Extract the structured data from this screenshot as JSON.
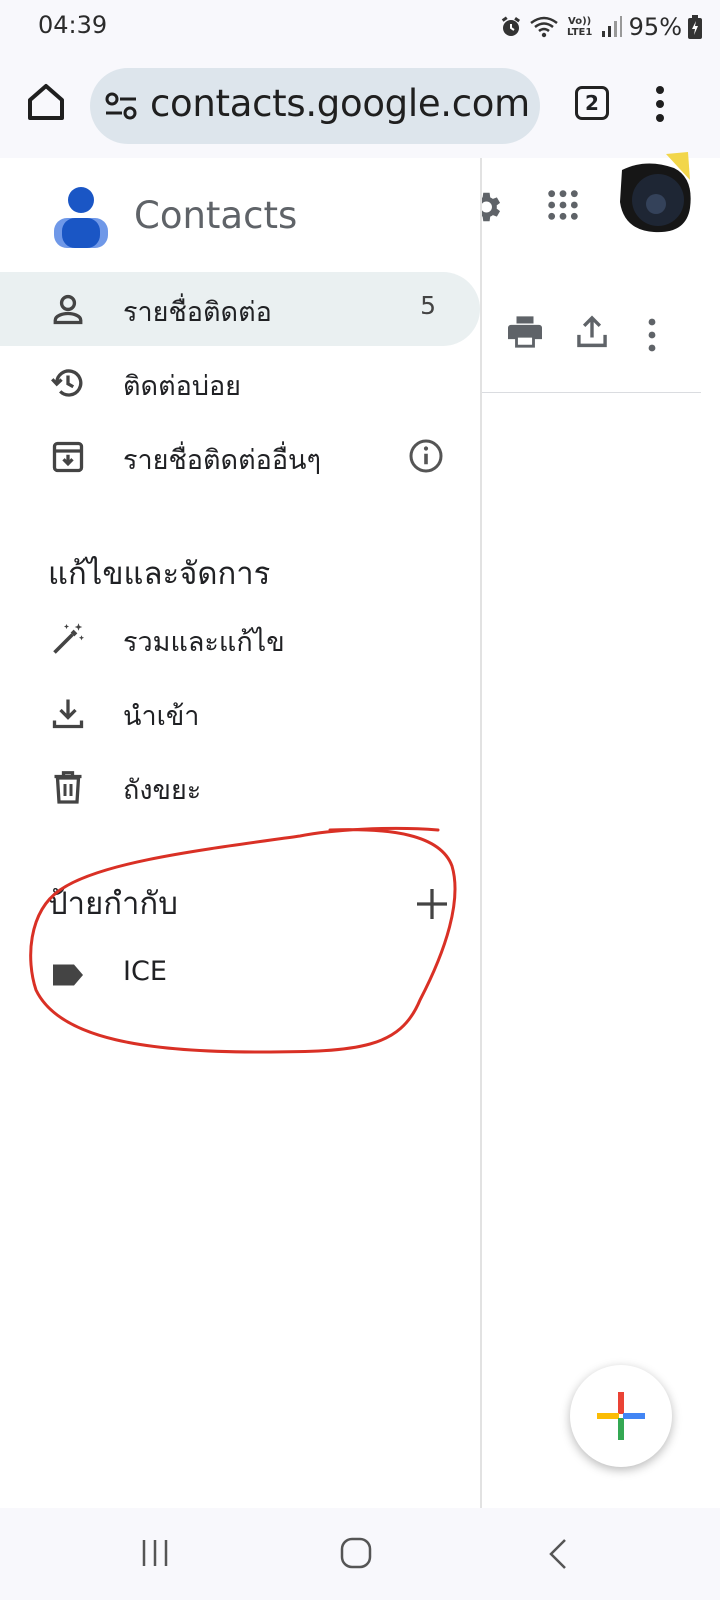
{
  "status_bar": {
    "time": "04:39",
    "network": "Vo)) LTE1",
    "battery": "95%"
  },
  "browser": {
    "url": "contacts.google.com",
    "tab_count": "2"
  },
  "app": {
    "title": "Contacts"
  },
  "nav": {
    "contacts": {
      "label": "รายชื่อติดต่อ",
      "count": "5"
    },
    "frequent": {
      "label": "ติดต่อบ่อย"
    },
    "other": {
      "label": "รายชื่อติดต่ออื่นๆ"
    }
  },
  "fix_manage": {
    "title": "แก้ไขและจัดการ",
    "merge": {
      "label": "รวมและแก้ไข"
    },
    "import": {
      "label": "นำเข้า"
    },
    "trash": {
      "label": "ถังขยะ"
    }
  },
  "labels": {
    "title": "ป้ายกำกับ",
    "items": [
      {
        "label": "ICE"
      }
    ]
  },
  "colors": {
    "annotation": "#d93025",
    "active_bg": "#eaf0f1",
    "accent_blue": "#1a56c5"
  }
}
